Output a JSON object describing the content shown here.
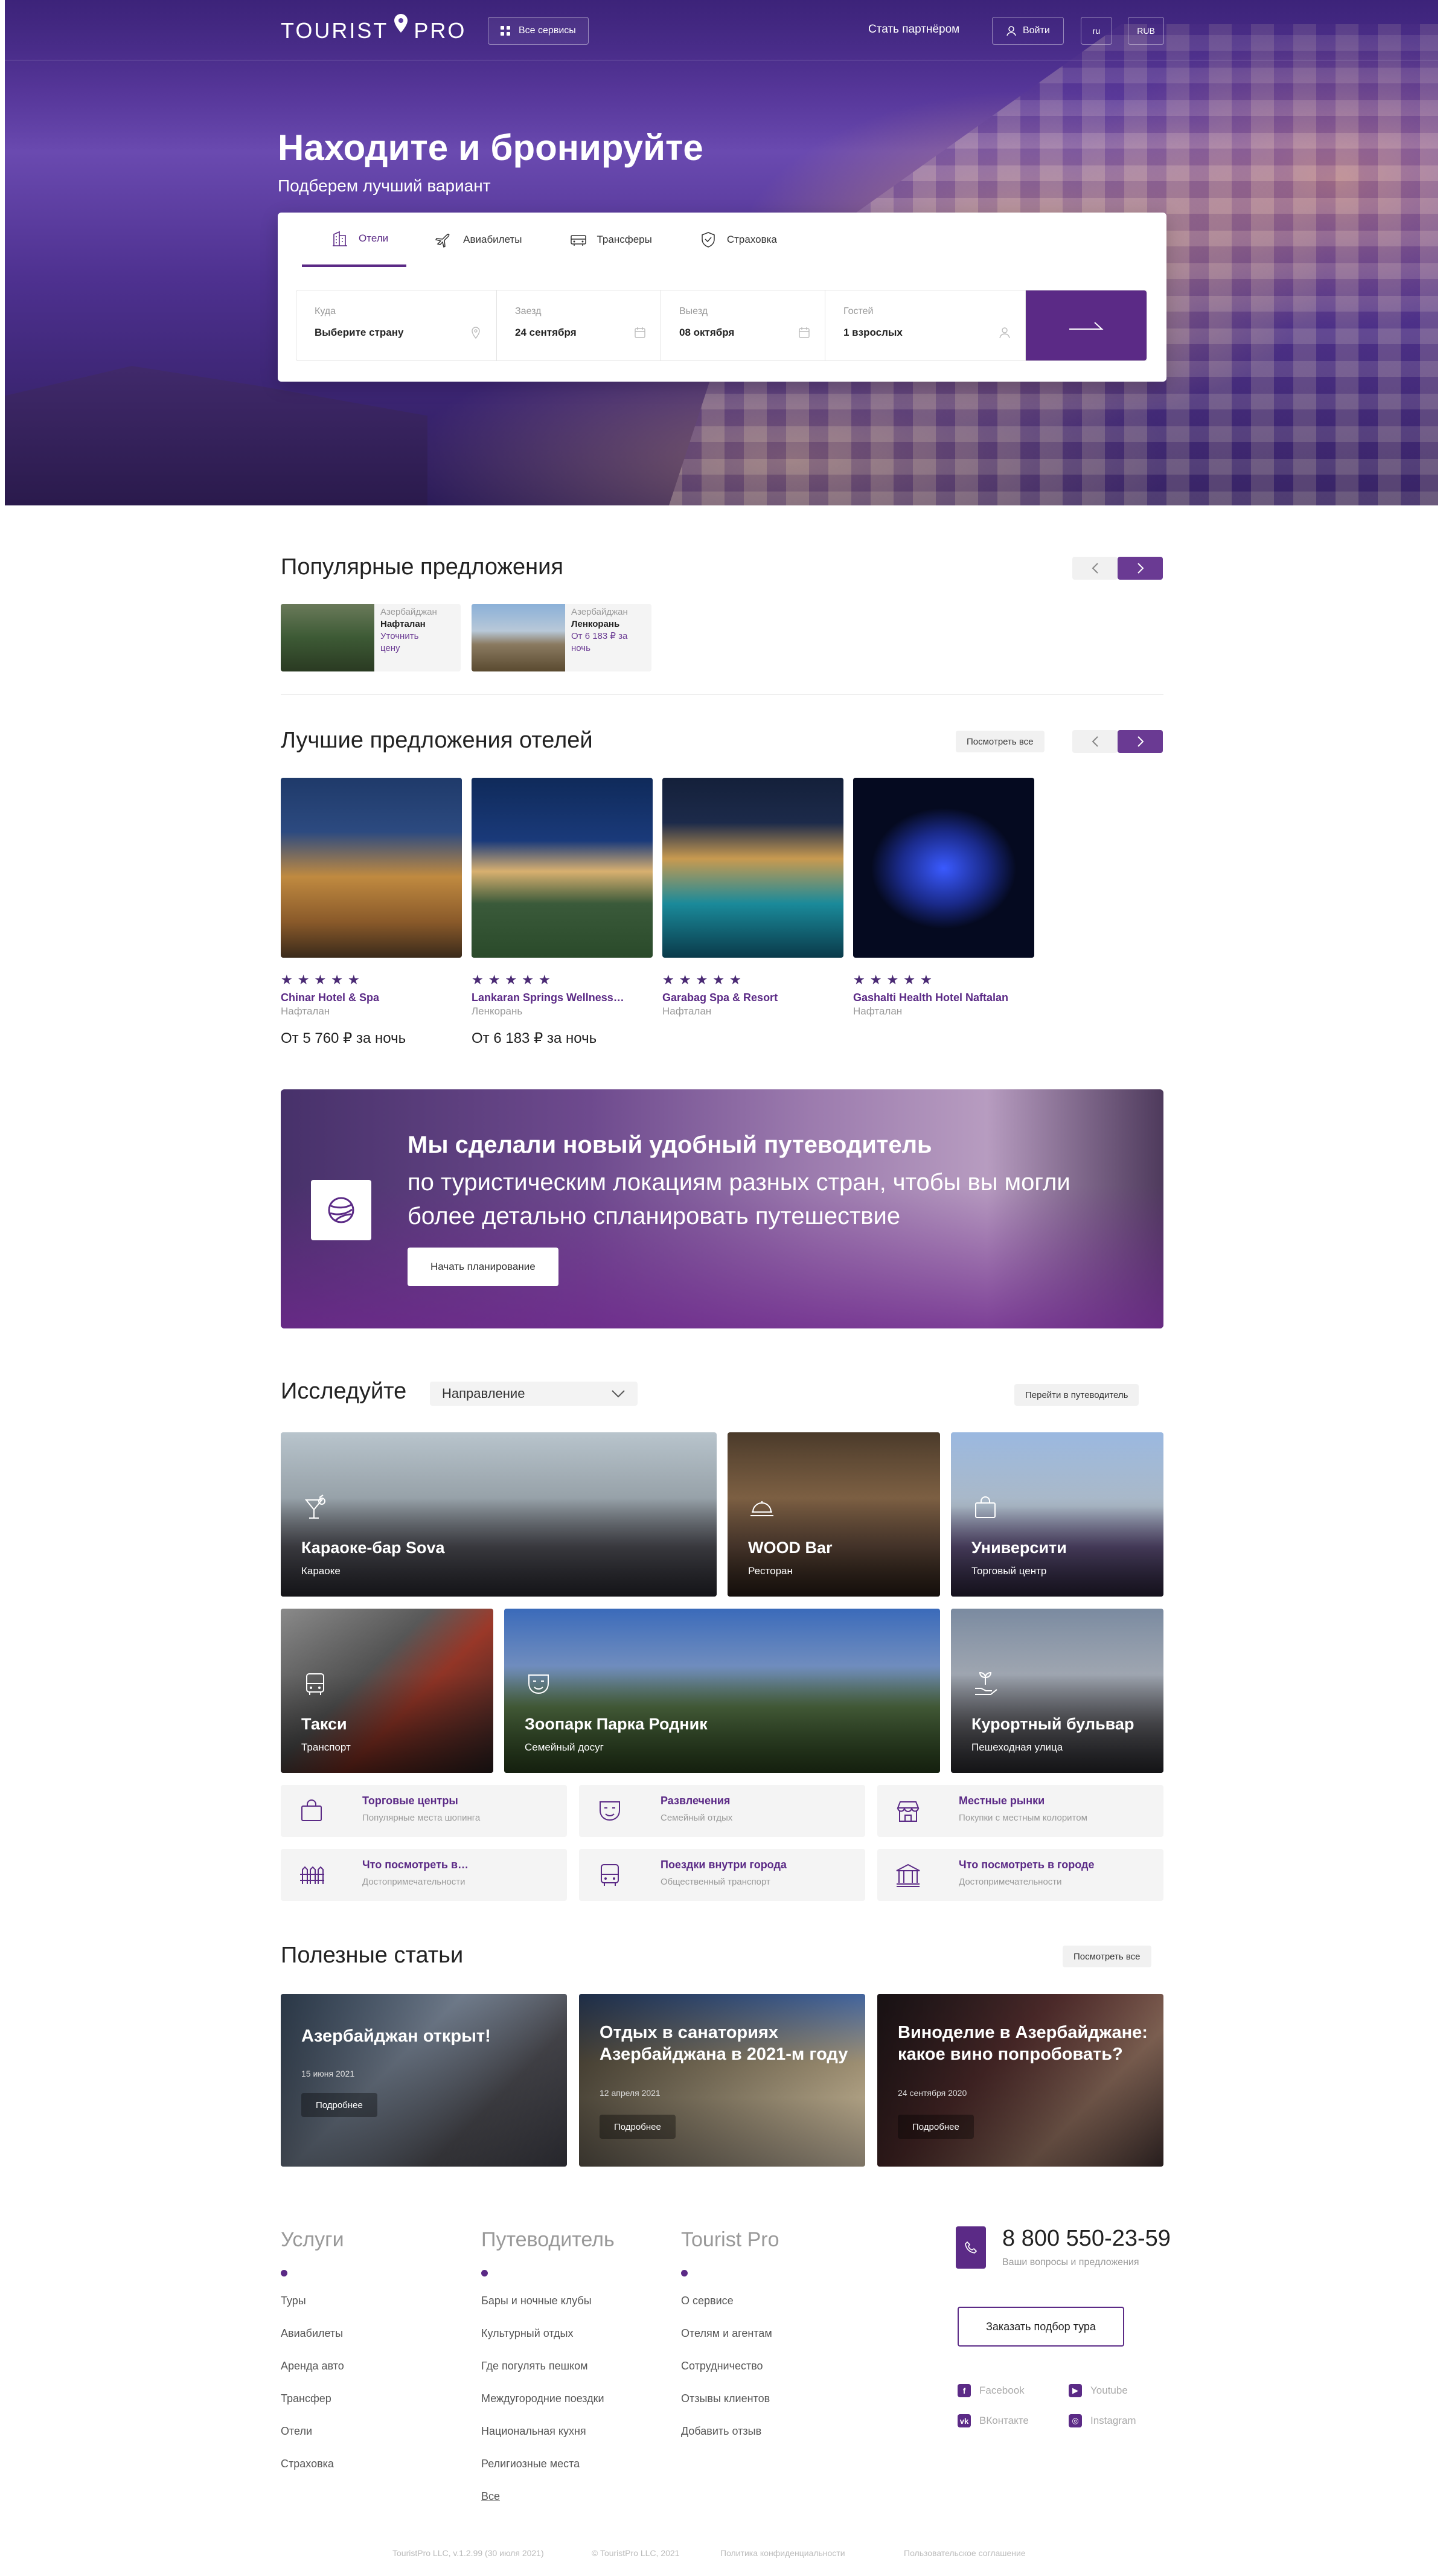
{
  "header": {
    "logo": "TOURIST PRO",
    "logo_left": "TOURIST",
    "logo_right": "PRO",
    "all_services": "Все сервисы",
    "partner": "Стать партнёром",
    "login": "Войти",
    "lang": "ru",
    "currency": "RUB"
  },
  "hero": {
    "title": "Находите и бронируйте",
    "subtitle": "Подберем лучший вариант"
  },
  "search": {
    "tabs": [
      {
        "label": "Отели",
        "icon": "hotel-icon"
      },
      {
        "label": "Авиабилеты",
        "icon": "plane-icon"
      },
      {
        "label": "Трансферы",
        "icon": "car-icon"
      },
      {
        "label": "Страховка",
        "icon": "shield-icon"
      }
    ],
    "fields": [
      {
        "label": "Куда",
        "value": "Выберите страну",
        "icon": "pin-icon"
      },
      {
        "label": "Заезд",
        "value": "24 сентября",
        "icon": "calendar-icon"
      },
      {
        "label": "Выезд",
        "value": "08 октября",
        "icon": "calendar-icon"
      },
      {
        "label": "Гостей",
        "value": "1 взрослых",
        "icon": "user-icon"
      }
    ]
  },
  "popular": {
    "title": "Популярные предложения",
    "items": [
      {
        "country": "Азербайджан",
        "name": "Нафталан",
        "price_line1": "Уточнить",
        "price_line2": "цену"
      },
      {
        "country": "Азербайджан",
        "name": "Ленкорань",
        "price_line1": "От 6 183 ₽ за",
        "price_line2": "ночь"
      }
    ]
  },
  "hotels": {
    "title": "Лучшие предложения отелей",
    "see_all": "Посмотреть все",
    "items": [
      {
        "name": "Chinar Hotel & Spa",
        "location": "Нафталан",
        "price": "От 5 760 ₽ за ночь",
        "stars": 5
      },
      {
        "name": "Lankaran Springs Wellness…",
        "location": "Ленкорань",
        "price": "От 6 183 ₽ за ночь",
        "stars": 5
      },
      {
        "name": "Garabag Spa & Resort",
        "location": "Нафталан",
        "price": "",
        "stars": 5
      },
      {
        "name": "Gashalti Health Hotel Naftalan",
        "location": "Нафталан",
        "price": "",
        "stars": 5
      }
    ]
  },
  "banner": {
    "title": "Мы сделали новый удобный путеводитель",
    "text": "по туристическим локациям разных стран, чтобы вы могли более детально спланировать путешествие",
    "button": "Начать планирование"
  },
  "explore": {
    "title": "Исследуйте",
    "direction": "Направление",
    "guide_link": "Перейти в путеводитель",
    "places": [
      {
        "name": "Караоке-бар Sova",
        "type": "Караоке",
        "icon": "cocktail-icon"
      },
      {
        "name": "WOOD Bar",
        "type": "Ресторан",
        "icon": "food-icon"
      },
      {
        "name": "Университи",
        "type": "Торговый центр",
        "icon": "bag-icon"
      },
      {
        "name": "Такси",
        "type": "Транспорт",
        "icon": "bus-icon"
      },
      {
        "name": "Зоопарк Парка Родник",
        "type": "Семейный досуг",
        "icon": "mask-icon"
      },
      {
        "name": "Курортный бульвар",
        "type": "Пешеходная улица",
        "icon": "hand-plant-icon"
      }
    ],
    "categories": [
      {
        "name": "Торговые центры",
        "desc": "Популярные места шопинга",
        "icon": "bag-icon"
      },
      {
        "name": "Развлечения",
        "desc": "Семейный отдых",
        "icon": "mask-icon"
      },
      {
        "name": "Местные рынки",
        "desc": "Покупки с местным колоритом",
        "icon": "store-icon"
      },
      {
        "name": "Что посмотреть в…",
        "desc": "Достопримечательности",
        "icon": "fence-icon"
      },
      {
        "name": "Поездки внутри города",
        "desc": "Общественный транспорт",
        "icon": "bus-icon"
      },
      {
        "name": "Что посмотреть в городе",
        "desc": "Достопримечательности",
        "icon": "museum-icon"
      }
    ]
  },
  "articles": {
    "title": "Полезные статьи",
    "see_all": "Посмотреть все",
    "items": [
      {
        "title": "Азербайджан открыт!",
        "date": "15 июня 2021",
        "button": "Подробнее"
      },
      {
        "title": "Отдых в санаториях Азербайджана в 2021-м году",
        "date": "12 апреля 2021",
        "button": "Подробнее"
      },
      {
        "title": "Виноделие в Азербайджане: какое вино попробовать?",
        "date": "24 сентября 2020",
        "button": "Подробнее"
      }
    ]
  },
  "footer": {
    "services": {
      "title": "Услуги",
      "links": [
        "Туры",
        "Авиабилеты",
        "Аренда авто",
        "Трансфер",
        "Отели",
        "Страховка"
      ]
    },
    "guide": {
      "title": "Путеводитель",
      "links": [
        "Бары и ночные клубы",
        "Культурный отдых",
        "Где погулять пешком",
        "Междугородние поездки",
        "Национальная кухня",
        "Религиозные места"
      ],
      "all": "Все"
    },
    "company": {
      "title": "Tourist Pro",
      "links": [
        "О сервисе",
        "Отелям и агентам",
        "Сотрудничество",
        "Отзывы клиентов",
        "Добавить отзыв"
      ]
    },
    "phone": "8 800 550-23-59",
    "phone_sub": "Ваши вопросы и предложения",
    "order_tour": "Заказать подбор тура",
    "social": {
      "facebook": "Facebook",
      "youtube": "Youtube",
      "vk": "ВКонтакте",
      "instagram": "Instagram"
    },
    "bottom": {
      "version": "TouristPro LLC, v.1.2.99 (30 июля 2021)",
      "copyright": "© TouristPro LLC, 2021",
      "privacy": "Политика конфиденциальности",
      "terms": "Пользовательское соглашение"
    }
  }
}
